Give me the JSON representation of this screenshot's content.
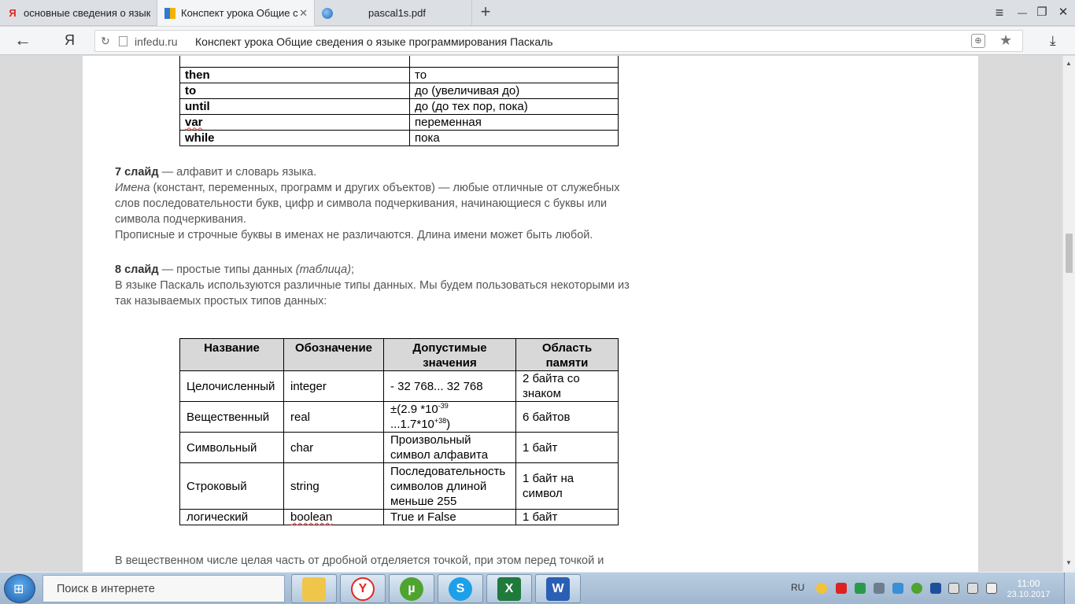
{
  "tabs": [
    {
      "title": "основные сведения о языке",
      "favicon": "Я",
      "active": false
    },
    {
      "title": "Конспект урока Общие с",
      "favicon": "",
      "active": true
    },
    {
      "title": "pascal1s.pdf",
      "favicon": "",
      "active": false
    }
  ],
  "newtab_symbol": "+",
  "window_controls": {
    "menu": "≡",
    "minimize": "—",
    "restore": "❐",
    "close": "✕"
  },
  "address": {
    "logo": "Я",
    "domain": "infedu.ru",
    "page_title": "Конспект урока Общие сведения о языке программирования Паскаль"
  },
  "keywords_table": [
    {
      "word": "then",
      "translation": "то"
    },
    {
      "word": "to",
      "translation": "до (увеличивая до)"
    },
    {
      "word": "until",
      "translation": "до (до тех пор, пока)"
    },
    {
      "word": "var",
      "translation": "переменная"
    },
    {
      "word": "while",
      "translation": "пока"
    }
  ],
  "slide7": {
    "label": "7 слайд",
    "rest": " — алфавит и словарь языка.",
    "names_em": "Имена",
    "line2": " (констант, переменных, программ и других объектов) — любые отличные от служебных",
    "line3": "слов последовательности букв, цифр и символа подчеркивания, начинающиеся с буквы или",
    "line4": "символа подчеркивания.",
    "line5": "Прописные и строчные буквы в именах не различаются. Длина имени может быть любой."
  },
  "slide8": {
    "label": "8 слайд",
    "rest": " — простые типы данных ",
    "em": "(таблица)",
    "semi": ";",
    "line2": "В языке Паскаль используются различные типы данных. Мы будем пользоваться некоторыми из",
    "line3": "так называемых простых типов данных:"
  },
  "types_table": {
    "headers": [
      "Название",
      "Обозначение",
      "Допустимые значения",
      "Область памяти"
    ],
    "rows": [
      {
        "name": "Целочисленный",
        "code": "integer",
        "range": "- 32 768... 32 768",
        "memory": "2 байта со знаком"
      },
      {
        "name": "Вещественный",
        "code": "real",
        "range_a": "±(2.9 *10",
        "exp1": "-39",
        "range_b": "...1.7*10",
        "exp2": "+38",
        "range_c": ")",
        "memory": "6 байтов"
      },
      {
        "name": "Символьный",
        "code": "char",
        "range": "Произвольный символ алфавита",
        "memory": "1 байт"
      },
      {
        "name": "Строковый",
        "code": "string",
        "range": "Последовательность символов длиной меньше 255",
        "memory": "1 байт на символ"
      },
      {
        "name": "логический",
        "code": "boolean",
        "range": "True и False",
        "memory": "1 байт"
      }
    ]
  },
  "footer_text": "В вещественном числе целая часть от дробной отделяется точкой, при этом перед точкой и",
  "taskbar": {
    "search_placeholder": "Поиск в интернете",
    "lang": "RU",
    "time": "11:00",
    "date": "23.10.2017"
  }
}
